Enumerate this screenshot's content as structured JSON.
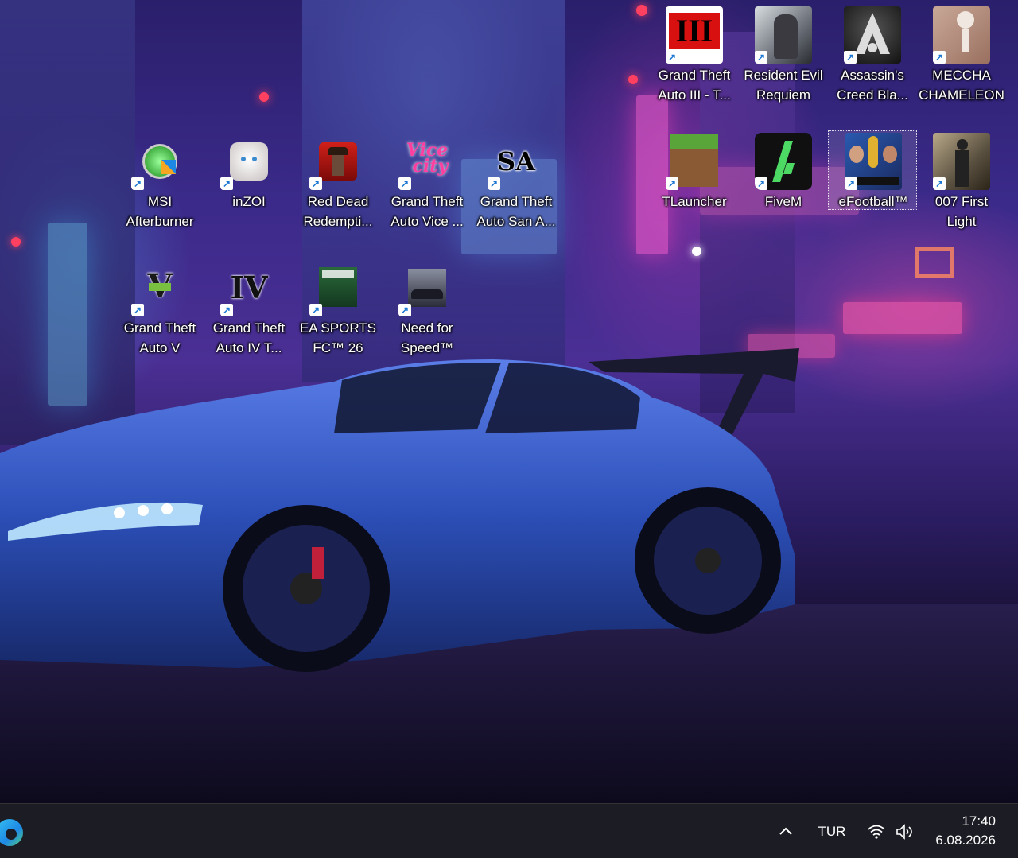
{
  "desktop": {
    "icons": [
      {
        "id": "gta3",
        "line1": "Grand Theft",
        "line2": "Auto III - T..."
      },
      {
        "id": "re-requiem",
        "line1": "Resident Evil",
        "line2": "Requiem"
      },
      {
        "id": "ac-black-flag",
        "line1": "Assassin's",
        "line2": "Creed Bla..."
      },
      {
        "id": "meccha",
        "line1": "MECCHA",
        "line2": "CHAMELEON"
      },
      {
        "id": "msi",
        "line1": "MSI",
        "line2": "Afterburner"
      },
      {
        "id": "inzoi",
        "line1": "inZOI",
        "line2": ""
      },
      {
        "id": "rdr",
        "line1": "Red Dead",
        "line2": "Redempti..."
      },
      {
        "id": "gtavc",
        "line1": "Grand Theft",
        "line2": "Auto Vice ..."
      },
      {
        "id": "gtasa",
        "line1": "Grand Theft",
        "line2": "Auto San A..."
      },
      {
        "id": "tlauncher",
        "line1": "TLauncher",
        "line2": ""
      },
      {
        "id": "fivem",
        "line1": "FiveM",
        "line2": ""
      },
      {
        "id": "efootball",
        "line1": "eFootball™",
        "line2": ""
      },
      {
        "id": "007",
        "line1": "007 First",
        "line2": "Light"
      },
      {
        "id": "gtav",
        "line1": "Grand Theft",
        "line2": "Auto V"
      },
      {
        "id": "gtaiv",
        "line1": "Grand Theft",
        "line2": "Auto IV T..."
      },
      {
        "id": "fc26",
        "line1": "EA SPORTS",
        "line2": "FC™ 26"
      },
      {
        "id": "nfs",
        "line1": "Need for",
        "line2": "Speed™"
      }
    ]
  },
  "taskbar": {
    "tray_chevron": "^",
    "language": "TUR",
    "time": "17:40",
    "date": "6.08.2026"
  }
}
